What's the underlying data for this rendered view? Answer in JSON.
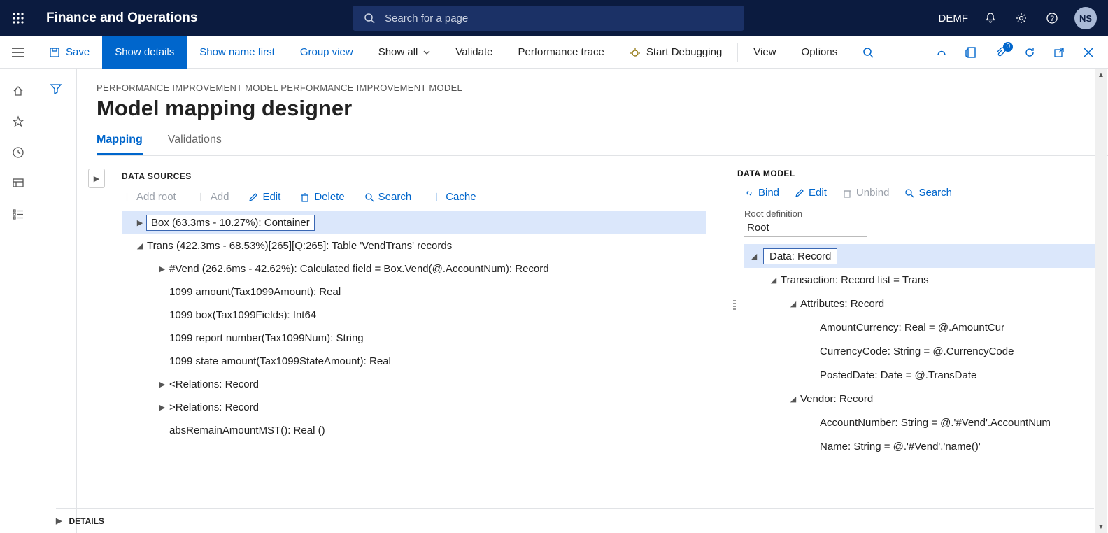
{
  "app": {
    "title": "Finance and Operations"
  },
  "topbar": {
    "search_placeholder": "Search for a page",
    "company": "DEMF",
    "avatar": "NS"
  },
  "cmdbar": {
    "save": "Save",
    "show_details": "Show details",
    "show_name_first": "Show name first",
    "group_view": "Group view",
    "show_all": "Show all",
    "validate": "Validate",
    "perf_trace": "Performance trace",
    "start_debugging": "Start Debugging",
    "view": "View",
    "options": "Options",
    "badge_count": "0"
  },
  "breadcrumb": "PERFORMANCE IMPROVEMENT MODEL PERFORMANCE IMPROVEMENT MODEL",
  "page_title": "Model mapping designer",
  "tabs": {
    "mapping": "Mapping",
    "validations": "Validations"
  },
  "ds": {
    "header": "DATA SOURCES",
    "tools": {
      "add_root": "Add root",
      "add": "Add",
      "edit": "Edit",
      "delete": "Delete",
      "search": "Search",
      "cache": "Cache"
    },
    "nodes": [
      {
        "level": 0,
        "arrow": "▶",
        "label": "Box (63.3ms - 10.27%): Container",
        "selected": true
      },
      {
        "level": 0,
        "arrow": "◢",
        "label": "Trans (422.3ms - 68.53%)[265][Q:265]: Table 'VendTrans' records"
      },
      {
        "level": 1,
        "arrow": "▶",
        "label": "#Vend (262.6ms - 42.62%): Calculated field = Box.Vend(@.AccountNum): Record"
      },
      {
        "level": 1,
        "arrow": "",
        "label": "1099 amount(Tax1099Amount): Real"
      },
      {
        "level": 1,
        "arrow": "",
        "label": "1099 box(Tax1099Fields): Int64"
      },
      {
        "level": 1,
        "arrow": "",
        "label": "1099 report number(Tax1099Num): String"
      },
      {
        "level": 1,
        "arrow": "",
        "label": "1099 state amount(Tax1099StateAmount): Real"
      },
      {
        "level": 1,
        "arrow": "▶",
        "label": "<Relations: Record"
      },
      {
        "level": 1,
        "arrow": "▶",
        "label": ">Relations: Record"
      },
      {
        "level": 1,
        "arrow": "",
        "label": "absRemainAmountMST(): Real ()"
      }
    ]
  },
  "dm": {
    "header": "DATA MODEL",
    "tools": {
      "bind": "Bind",
      "edit": "Edit",
      "unbind": "Unbind",
      "search": "Search"
    },
    "rootdef_label": "Root definition",
    "rootdef_value": "Root",
    "nodes": [
      {
        "level": 0,
        "arrow": "◢",
        "label": "Data: Record",
        "selected": true
      },
      {
        "level": 1,
        "arrow": "◢",
        "label": "Transaction: Record list = Trans"
      },
      {
        "level": 2,
        "arrow": "◢",
        "label": "Attributes: Record"
      },
      {
        "level": 3,
        "arrow": "",
        "label": "AmountCurrency: Real = @.AmountCur"
      },
      {
        "level": 3,
        "arrow": "",
        "label": "CurrencyCode: String = @.CurrencyCode"
      },
      {
        "level": 3,
        "arrow": "",
        "label": "PostedDate: Date = @.TransDate"
      },
      {
        "level": 2,
        "arrow": "◢",
        "label": "Vendor: Record"
      },
      {
        "level": 3,
        "arrow": "",
        "label": "AccountNumber: String = @.'#Vend'.AccountNum"
      },
      {
        "level": 3,
        "arrow": "",
        "label": "Name: String = @.'#Vend'.'name()'"
      }
    ]
  },
  "details": "DETAILS"
}
